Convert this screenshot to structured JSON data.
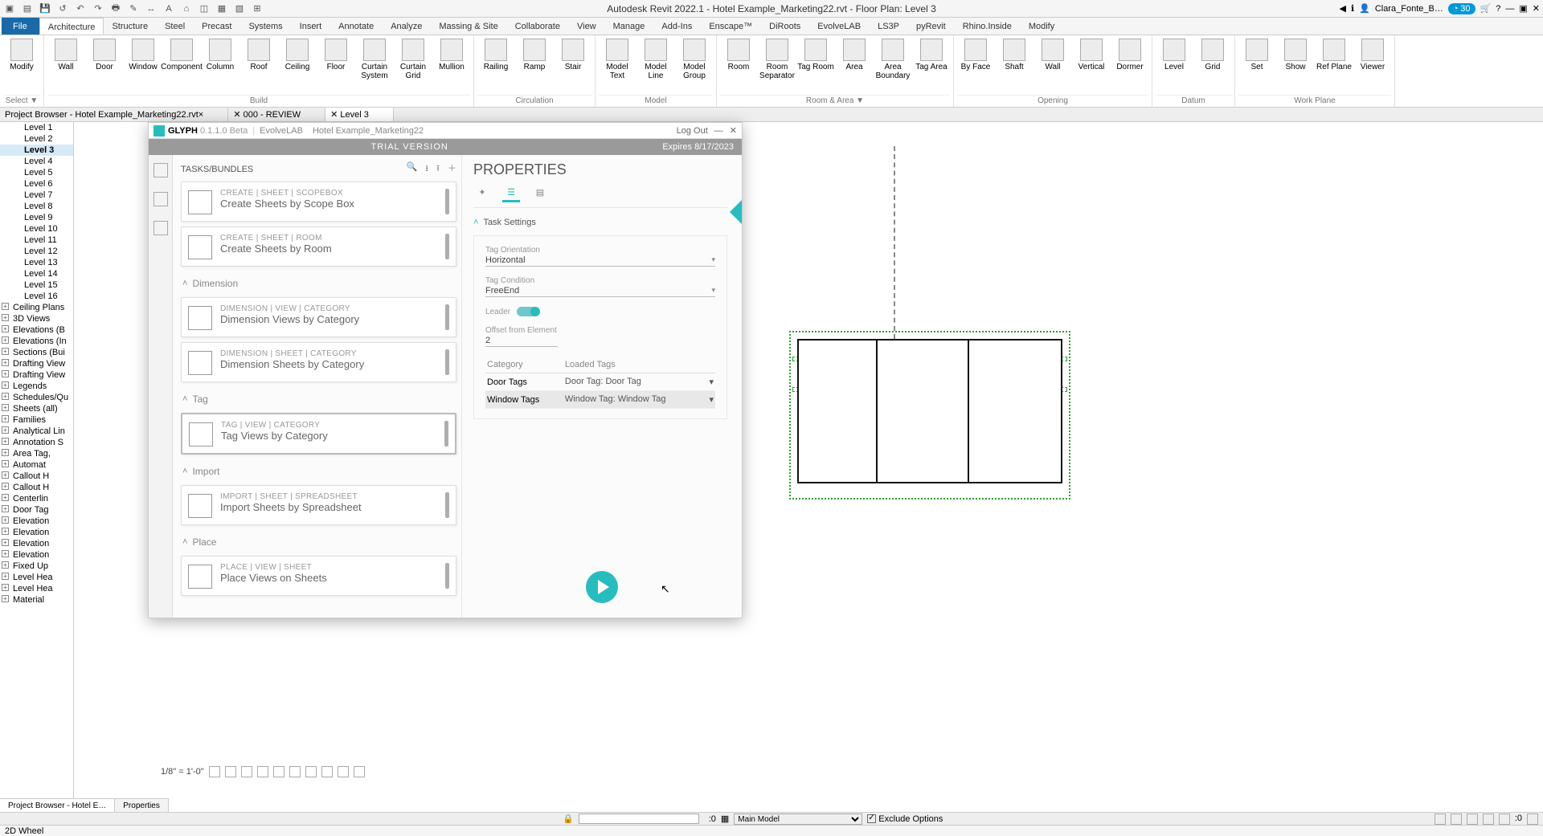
{
  "app": {
    "title": "Autodesk Revit 2022.1 - Hotel Example_Marketing22.rvt - Floor Plan: Level 3",
    "user": "Clara_Fonte_B…",
    "credits": "30"
  },
  "ribbon_tabs": [
    "File",
    "Architecture",
    "Structure",
    "Steel",
    "Precast",
    "Systems",
    "Insert",
    "Annotate",
    "Analyze",
    "Massing & Site",
    "Collaborate",
    "View",
    "Manage",
    "Add-Ins",
    "Enscape™",
    "DiRoots",
    "EvolveLAB",
    "LS3P",
    "pyRevit",
    "Rhino.Inside",
    "Modify"
  ],
  "ribbon_active": 1,
  "panels": [
    {
      "label": "Select ▼",
      "items": [
        "Modify"
      ]
    },
    {
      "label": "Build",
      "items": [
        "Wall",
        "Door",
        "Window",
        "Component",
        "Column",
        "Roof",
        "Ceiling",
        "Floor",
        "Curtain System",
        "Curtain Grid",
        "Mullion"
      ]
    },
    {
      "label": "Circulation",
      "items": [
        "Railing",
        "Ramp",
        "Stair"
      ]
    },
    {
      "label": "Model",
      "items": [
        "Model Text",
        "Model Line",
        "Model Group"
      ]
    },
    {
      "label": "Room & Area ▼",
      "items": [
        "Room",
        "Room Separator",
        "Tag Room",
        "Area",
        "Area Boundary",
        "Tag Area"
      ]
    },
    {
      "label": "Opening",
      "items": [
        "By Face",
        "Shaft",
        "Wall",
        "Vertical",
        "Dormer"
      ]
    },
    {
      "label": "Datum",
      "items": [
        "Level",
        "Grid"
      ]
    },
    {
      "label": "Work Plane",
      "items": [
        "Set",
        "Show",
        "Ref Plane",
        "Viewer"
      ]
    }
  ],
  "docbar": {
    "left": "Project Browser - Hotel Example_Marketing22.rvt",
    "mid": "000 - REVIEW",
    "right": "Level 3"
  },
  "project_browser": {
    "levels": [
      "Level 1",
      "Level 2",
      "Level 3",
      "Level 4",
      "Level 5",
      "Level 6",
      "Level 7",
      "Level 8",
      "Level 9",
      "Level 10",
      "Level 11",
      "Level 12",
      "Level 13",
      "Level 14",
      "Level 15",
      "Level 16"
    ],
    "sel": "Level 3",
    "rest": [
      "Ceiling Plans",
      "3D Views",
      "Elevations (B",
      "Elevations (In",
      "Sections (Bui",
      "Drafting View",
      "Drafting View",
      "Legends",
      "Schedules/Qu",
      "Sheets (all)",
      "Families",
      "Analytical Lin",
      "Annotation S",
      "Area Tag,",
      "Automat",
      "Callout H",
      "Callout H",
      "Centerlin",
      "Door Tag",
      "Elevation",
      "Elevation",
      "Elevation",
      "Elevation",
      "Fixed Up",
      "Level Hea",
      "Level Hea",
      "Material"
    ]
  },
  "glyph": {
    "brand": "GLYPH",
    "ver": "0.1.1.0 Beta",
    "sub1": "EvolveLAB",
    "sub2": "Hotel Example_Marketing22",
    "logout": "Log Out",
    "trial": "TRIAL VERSION",
    "expires": "Expires 8/17/2023",
    "tasks_title": "TASKS/BUNDLES",
    "cards": [
      {
        "path": "CREATE  |  SHEET  |  SCOPEBOX",
        "name": "Create Sheets by Scope Box"
      },
      {
        "path": "CREATE  |  SHEET  |  ROOM",
        "name": "Create Sheets by Room"
      }
    ],
    "groups": [
      {
        "h": "Dimension",
        "cards": [
          {
            "path": "DIMENSION  |  VIEW  |  CATEGORY",
            "name": "Dimension Views by Category"
          },
          {
            "path": "DIMENSION  |  SHEET  |  CATEGORY",
            "name": "Dimension Sheets by Category"
          }
        ]
      },
      {
        "h": "Tag",
        "cards": [
          {
            "path": "TAG  |  VIEW  |  CATEGORY",
            "name": "Tag Views by Category",
            "sel": true
          }
        ]
      },
      {
        "h": "Import",
        "cards": [
          {
            "path": "IMPORT  |  SHEET  |  SPREADSHEET",
            "name": "Import Sheets by Spreadsheet"
          }
        ]
      },
      {
        "h": "Place",
        "cards": [
          {
            "path": "PLACE  |  VIEW  |  SHEET",
            "name": "Place Views on Sheets"
          }
        ]
      }
    ],
    "props_title": "PROPERTIES",
    "section": "Task Settings",
    "fields": {
      "tag_orientation": {
        "label": "Tag Orientation",
        "value": "Horizontal"
      },
      "tag_condition": {
        "label": "Tag Condition",
        "value": "FreeEnd"
      },
      "leader": {
        "label": "Leader"
      },
      "offset": {
        "label": "Offset from Element",
        "value": "2"
      }
    },
    "table": {
      "h1": "Category",
      "h2": "Loaded Tags",
      "rows": [
        {
          "c": "Door Tags",
          "t": "Door Tag: Door Tag"
        },
        {
          "c": "Window Tags",
          "t": "Window Tag: Window Tag",
          "hl": true
        }
      ]
    }
  },
  "footer": {
    "tabs": [
      "Project Browser - Hotel E…",
      "Properties"
    ],
    "scale": "1/8\" = 1'-0\"",
    "worksets": "Main Model",
    "exclude": "Exclude Options",
    "so": ":0",
    "status": "2D Wheel"
  }
}
